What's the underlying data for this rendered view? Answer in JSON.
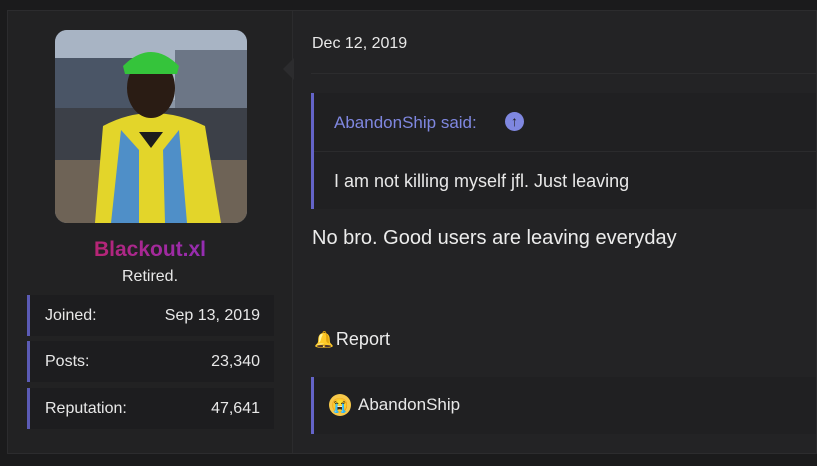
{
  "user": {
    "name": "Blackout.xl",
    "title": "Retired.",
    "stats": [
      {
        "label": "Joined:",
        "value": "Sep 13, 2019"
      },
      {
        "label": "Posts:",
        "value": "23,340"
      },
      {
        "label": "Reputation:",
        "value": "47,641"
      }
    ]
  },
  "post": {
    "date": "Dec 12, 2019",
    "quote": {
      "author_said": "AbandonShip said:",
      "text": "I am not killing myself jfl. Just leaving"
    },
    "message": "No bro. Good users are leaving everyday",
    "report_label": "Report",
    "reactions": [
      {
        "icon": "crying-emoji",
        "user": "AbandonShip"
      }
    ]
  },
  "colors": {
    "accent": "#6464c8",
    "quote_author": "#7f87e0",
    "username_gradient": [
      "#d11e3c",
      "#7a35d8"
    ]
  }
}
